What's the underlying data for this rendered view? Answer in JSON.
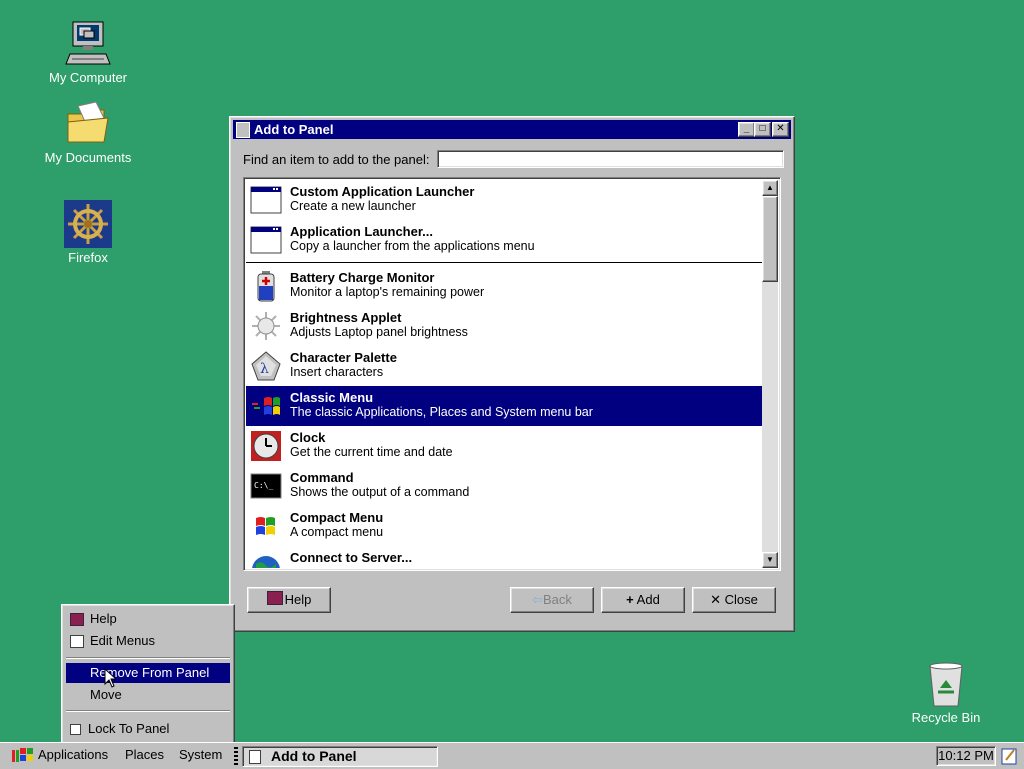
{
  "desktop": {
    "icons": [
      {
        "label": "My Computer",
        "icon": "computer-icon"
      },
      {
        "label": "My Documents",
        "icon": "folder-icon"
      },
      {
        "label": "Firefox",
        "icon": "ship-wheel-icon"
      },
      {
        "label": "Recycle Bin",
        "icon": "recycle-bin-icon"
      }
    ]
  },
  "dialog": {
    "title": "Add to Panel",
    "find_label": "Find an item to add to the panel:",
    "find_value": "",
    "items": [
      {
        "name": "Custom Application Launcher",
        "desc": "Create a new launcher",
        "icon": "window-icon"
      },
      {
        "name": "Application Launcher...",
        "desc": "Copy a launcher from the applications menu",
        "icon": "window-icon"
      },
      {
        "name": "Battery Charge Monitor",
        "desc": "Monitor a laptop's remaining power",
        "icon": "battery-icon"
      },
      {
        "name": "Brightness Applet",
        "desc": "Adjusts Laptop panel brightness",
        "icon": "sun-icon"
      },
      {
        "name": "Character Palette",
        "desc": "Insert characters",
        "icon": "lambda-key-icon"
      },
      {
        "name": "Classic Menu",
        "desc": "The classic Applications, Places and System menu bar",
        "icon": "windows-flag-icon",
        "selected": true
      },
      {
        "name": "Clock",
        "desc": "Get the current time and date",
        "icon": "clock-icon"
      },
      {
        "name": "Command",
        "desc": "Shows the output of a command",
        "icon": "terminal-icon"
      },
      {
        "name": "Compact Menu",
        "desc": "A compact menu",
        "icon": "windows-flag-icon"
      },
      {
        "name": "Connect to Server...",
        "desc": "",
        "icon": "globe-icon"
      }
    ],
    "buttons": {
      "help": "Help",
      "back": "Back",
      "add": "Add",
      "close": "Close"
    }
  },
  "context_menu": {
    "help": "Help",
    "edit_menus": "Edit Menus",
    "remove": "Remove From Panel",
    "move": "Move",
    "lock": "Lock To Panel"
  },
  "taskbar": {
    "applications": "Applications",
    "places": "Places",
    "system": "System",
    "task": "Add to Panel",
    "clock": "10:12 PM"
  },
  "colors": {
    "desktop": "#2e9e6a",
    "selection": "#000080",
    "face": "#c0c0c0"
  }
}
